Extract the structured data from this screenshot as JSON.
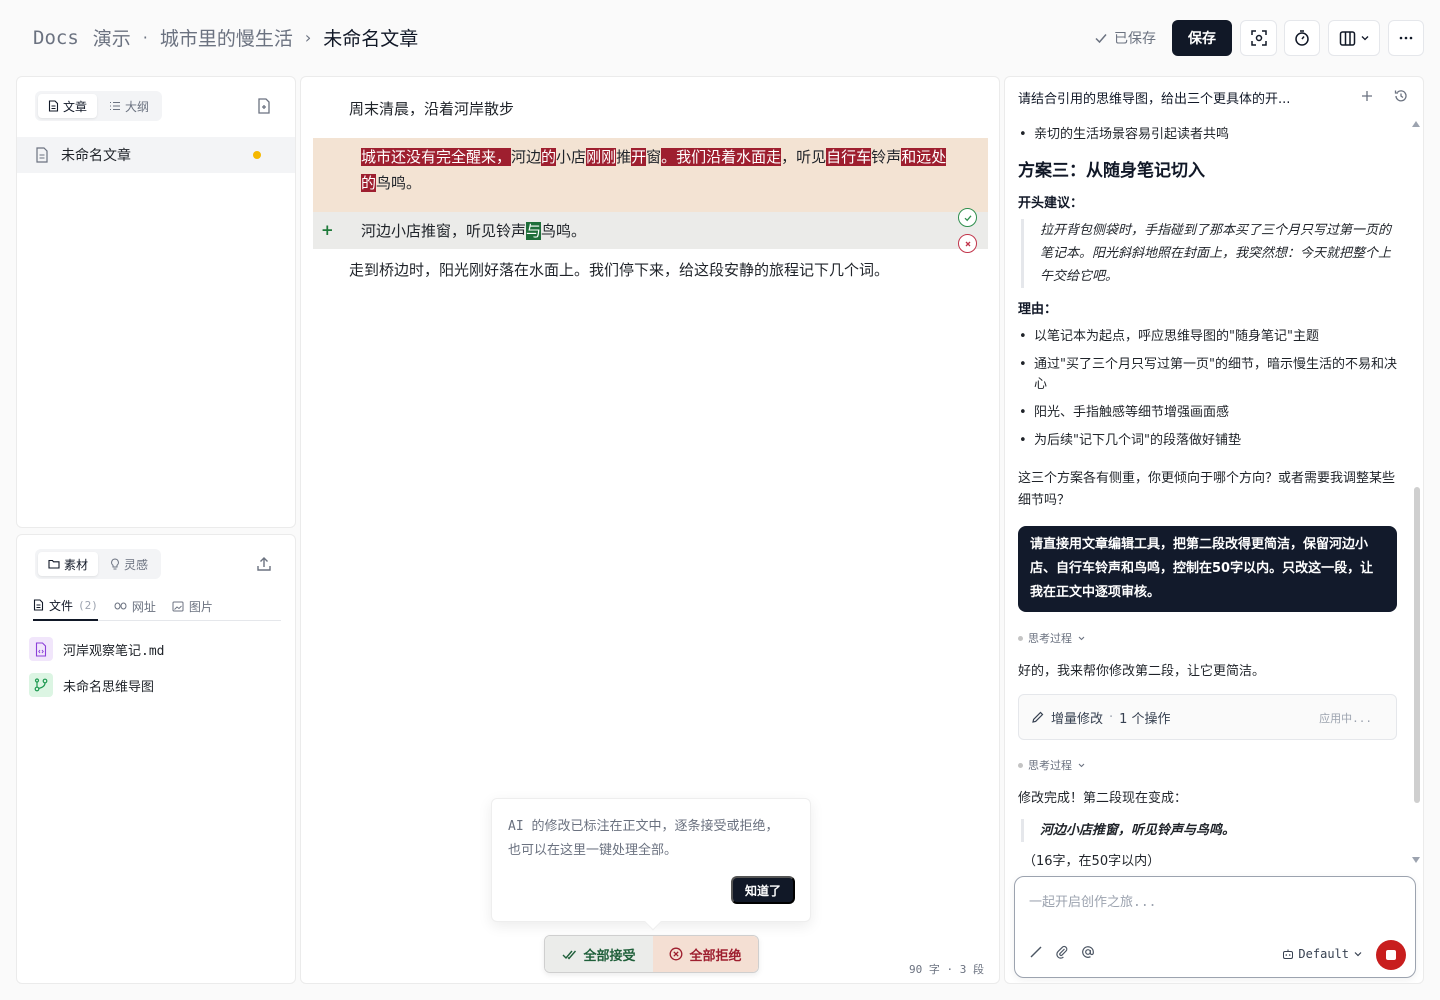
{
  "header": {
    "root": "Docs",
    "workspace": "演示",
    "dot": "·",
    "project": "城市里的慢生活",
    "sep": "›",
    "document": "未命名文章",
    "saved_label": "已保存",
    "save_button": "保存"
  },
  "files_panel": {
    "tabs": [
      {
        "label": "文章",
        "icon": "document-icon"
      },
      {
        "label": "大纲",
        "icon": "list-icon"
      }
    ],
    "items": [
      {
        "name": "未命名文章",
        "dirty": true
      }
    ]
  },
  "materials_panel": {
    "tabs": [
      {
        "label": "素材",
        "icon": "folder-icon"
      },
      {
        "label": "灵感",
        "icon": "lightbulb-icon"
      }
    ],
    "subtabs": [
      {
        "label": "文件",
        "count": "(2)"
      },
      {
        "label": "网址"
      },
      {
        "label": "图片"
      }
    ],
    "items": [
      {
        "name": "河岸观察笔记.md",
        "icon": "file-code-icon"
      },
      {
        "name": "未命名思维导图",
        "icon": "mindmap-icon"
      }
    ]
  },
  "editor": {
    "para1": "周末清晨，沿着河岸散步",
    "deleted_segments": [
      {
        "t": "城市还没有完全醒来，",
        "d": true
      },
      {
        "t": "河边",
        "d": false
      },
      {
        "t": "的",
        "d": true
      },
      {
        "t": "小店",
        "d": false
      },
      {
        "t": "刚刚",
        "d": true
      },
      {
        "t": "推",
        "d": false
      },
      {
        "t": "开",
        "d": true
      },
      {
        "t": "窗",
        "d": false
      },
      {
        "t": "。我们沿着水面走",
        "d": true
      },
      {
        "t": "，听见",
        "d": false
      },
      {
        "t": "自行车",
        "d": true
      },
      {
        "t": "铃声",
        "d": false
      },
      {
        "t": "和远处的",
        "d": true
      },
      {
        "t": "鸟鸣。",
        "d": false
      }
    ],
    "added_prefix": "河边小店推窗，听见铃声",
    "added_insert": "与",
    "added_suffix": "鸟鸣。",
    "plus": "+",
    "para3": "走到桥边时，阳光刚好落在水面上。我们停下来，给这段安静的旅程记下几个词。",
    "tooltip_text": "AI 的修改已标注在正文中，逐条接受或拒绝，也可以在这里一键处理全部。",
    "tooltip_button": "知道了",
    "accept_all": "全部接受",
    "reject_all": "全部拒绝",
    "word_count": "90 字 · 3 段"
  },
  "chat": {
    "title": "请结合引用的思维导图，给出三个更具体的开...",
    "top_bullet": "亲切的生活场景容易引起读者共鸣",
    "plan_heading": "方案三：从随身笔记切入",
    "opening_label": "开头建议：",
    "opening_quote": "拉开背包侧袋时，手指碰到了那本买了三个月只写过第一页的笔记本。阳光斜斜地照在封面上，我突然想：今天就把整个上午交给它吧。",
    "reason_label": "理由：",
    "reasons": [
      "以笔记本为起点，呼应思维导图的\"随身笔记\"主题",
      "通过\"买了三个月只写过第一页\"的细节，暗示慢生活的不易和决心",
      "阳光、手指触感等细节增强画面感",
      "为后续\"记下几个词\"的段落做好铺垫"
    ],
    "closing": "这三个方案各有侧重，你更倾向于哪个方向？或者需要我调整某些细节吗？",
    "user_message": "请直接用文章编辑工具，把第二段改得更简洁，保留河边小店、自行车铃声和鸟鸣，控制在50字以内。只改这一段，让我在正文中逐项审核。",
    "thinking_label": "思考过程",
    "reply1": "好的，我来帮你修改第二段，让它更简洁。",
    "tool_label": "增量修改",
    "tool_dot": "·",
    "tool_ops": "1 个操作",
    "tool_status": "应用中...",
    "done_text": "修改完成！第二段现在变成：",
    "done_quote": "河边小店推窗，听见铃声与鸟鸣。",
    "done_note": "（16字，在50字以内）",
    "composer_placeholder": "一起开启创作之旅...",
    "model": "Default"
  }
}
